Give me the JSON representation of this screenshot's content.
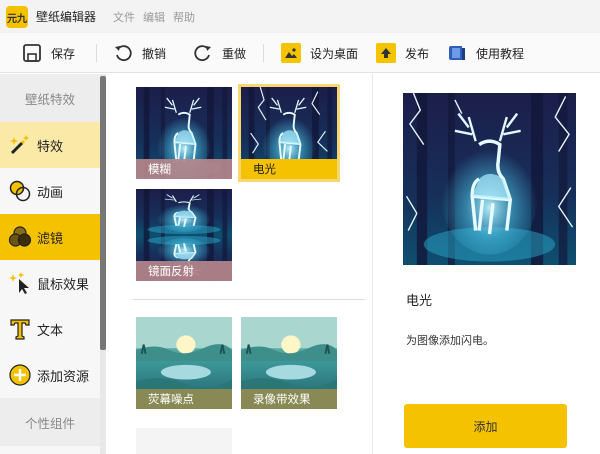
{
  "app": {
    "logo_text": "元九",
    "name": "壁纸编辑器"
  },
  "menu": [
    "文件",
    "编辑",
    "帮助"
  ],
  "toolbar": {
    "save": "保存",
    "undo": "撤销",
    "redo": "重做",
    "set_desktop": "设为桌面",
    "publish": "发布",
    "tutorial": "使用教程"
  },
  "sidebar": {
    "section_effects": "壁纸特效",
    "items": [
      {
        "label": "特效",
        "icon": "magic-wand-icon"
      },
      {
        "label": "动画",
        "icon": "animation-icon"
      },
      {
        "label": "滤镜",
        "icon": "filter-icon"
      },
      {
        "label": "鼠标效果",
        "icon": "cursor-sparkle-icon"
      },
      {
        "label": "文本",
        "icon": "text-icon"
      },
      {
        "label": "添加资源",
        "icon": "add-circle-icon"
      }
    ],
    "section_components": "个性组件"
  },
  "gallery": {
    "items": [
      {
        "label": "模糊"
      },
      {
        "label": "电光"
      },
      {
        "label": "镜面反射"
      },
      {
        "label": "荧幕噪点"
      },
      {
        "label": "录像带效果"
      }
    ]
  },
  "detail": {
    "title": "电光",
    "description": "为图像添加闪电。",
    "add_button": "添加"
  },
  "colors": {
    "accent": "#f5c200",
    "active_bg": "#fbe9a8",
    "selected_sidebar": "#f5c200",
    "caption_pink": "#b5868b",
    "caption_olive": "#8d8a52"
  }
}
